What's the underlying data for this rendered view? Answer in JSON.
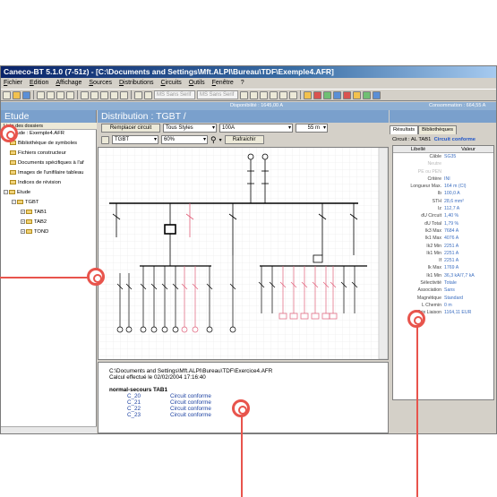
{
  "window": {
    "title": "Caneco-BT 5.1.0 (7-51z) - [C:\\Documents and Settings\\Mft.ALPI\\Bureau\\TDF\\Exemple4.AFR]"
  },
  "menu": [
    "Fichier",
    "Edition",
    "Affichage",
    "Sources",
    "Distributions",
    "Circuits",
    "Outils",
    "Fenêtre",
    "?"
  ],
  "toolbar": {
    "font_name_1": "MS Sans Serif",
    "font_name_2": "MS Sans Serif"
  },
  "info_strip": {
    "disponibilite": "Disponibilité : 1645,00 A",
    "consommation": "Consommation : 664,55 A"
  },
  "left_panel": {
    "title": "Etude",
    "tree_header": "Liste des dossiers",
    "root": "Etude : Exemple4.AFR",
    "items": [
      "Bibliothèque de symboles",
      "Fichiers constructeur",
      "Documents spécifiques à l'af",
      "Images de l'unifilaire tableau",
      "Indices de révision",
      "Etude",
      "TGBT",
      "TAB1",
      "TAB2",
      "TOND"
    ]
  },
  "main": {
    "title": "Distribution : TGBT /",
    "replace_button": "Remplacer circuit",
    "styles_select": "Tous Styles",
    "current_select": "100A",
    "length_field": "55 m",
    "distribution_select": "TGBT",
    "zoom_select": "60%",
    "refresh_button": "Rafraichir"
  },
  "report": {
    "path": "C:\\Documents and Settings\\Mft.ALPI\\Bureau\\TDF\\Exercice4.AFR",
    "computed": "Calcul effectué le 02/02/2004 17:16:40",
    "section": "normal-secours TAB1",
    "rows": [
      {
        "circuit": "C_20",
        "status": "Circuit conforme"
      },
      {
        "circuit": "C_21",
        "status": "Circuit conforme"
      },
      {
        "circuit": "C_22",
        "status": "Circuit conforme"
      },
      {
        "circuit": "C_23",
        "status": "Circuit conforme"
      }
    ]
  },
  "right_panel": {
    "tabs": [
      "Résultats",
      "Bibliothèques"
    ],
    "circuit_label": "Circuit : AL TAB1",
    "circuit_status": "Circuit conforme",
    "columns": [
      "Libellé",
      "Valeur"
    ],
    "rows": [
      {
        "k": "Câble",
        "v": "SG35",
        "muted": false
      },
      {
        "k": "Neutre",
        "v": "",
        "muted": true
      },
      {
        "k": "PE ou PEN",
        "v": "",
        "muted": true
      },
      {
        "k": "Critère",
        "v": "INI",
        "muted": false
      },
      {
        "k": "Longueur Max.",
        "v": "164 m (CI)",
        "muted": false
      },
      {
        "k": "Ib",
        "v": "100,0 A",
        "muted": false
      },
      {
        "k": "STH",
        "v": "28,6 mm²",
        "muted": false
      },
      {
        "k": "Iz",
        "v": "112,7 A",
        "muted": false
      },
      {
        "k": "dU Circuit",
        "v": "1,40 %",
        "muted": false
      },
      {
        "k": "dU Total",
        "v": "1,79 %",
        "muted": false
      },
      {
        "k": "Ik3 Max",
        "v": "7684 A",
        "muted": false
      },
      {
        "k": "Ik1 Max",
        "v": "4076 A",
        "muted": false
      },
      {
        "k": "Ik2 Min",
        "v": "2251 A",
        "muted": false
      },
      {
        "k": "Ik1 Min",
        "v": "2251 A",
        "muted": false
      },
      {
        "k": "If",
        "v": "2251 A",
        "muted": false
      },
      {
        "k": "Ik Max",
        "v": "1769 A",
        "muted": false
      },
      {
        "k": "Ik1 Min",
        "v": "36,3 kA/7,7 kA",
        "muted": false
      },
      {
        "k": "Sélectivité",
        "v": "Totale",
        "muted": false
      },
      {
        "k": "Association",
        "v": "Sans",
        "muted": false
      },
      {
        "k": "Magnétique",
        "v": "Standard",
        "muted": false
      },
      {
        "k": "L Chemin",
        "v": "0 m",
        "muted": false
      },
      {
        "k": "Prix Liaison",
        "v": "1164,11 EUR",
        "muted": false
      }
    ]
  }
}
